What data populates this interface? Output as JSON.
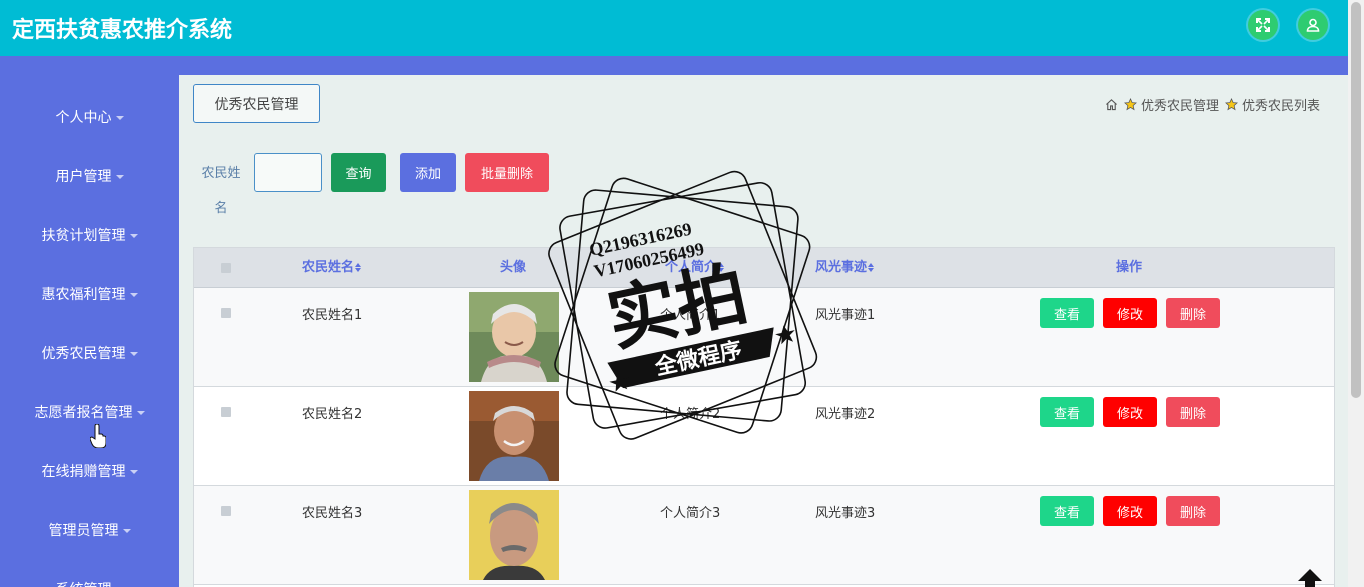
{
  "app": {
    "title": "定西扶贫惠农推介系统"
  },
  "header": {
    "fullscreen_icon": "fullscreen-icon",
    "user_icon": "user-icon",
    "accent_color": "#00bcd4",
    "button_color": "#2ecc71"
  },
  "sidebar": {
    "color": "#5b6fe0",
    "items": [
      {
        "label": "个人中心"
      },
      {
        "label": "用户管理"
      },
      {
        "label": "扶贫计划管理"
      },
      {
        "label": "惠农福利管理"
      },
      {
        "label": "优秀农民管理"
      },
      {
        "label": "志愿者报名管理"
      },
      {
        "label": "在线捐赠管理"
      },
      {
        "label": "管理员管理"
      },
      {
        "label": "系统管理"
      }
    ]
  },
  "page": {
    "title": "优秀农民管理",
    "breadcrumb": [
      "优秀农民管理",
      "优秀农民列表"
    ]
  },
  "search": {
    "label": "农民姓名",
    "value": "",
    "query_button": "查询",
    "add_button": "添加",
    "batch_delete_button": "批量删除"
  },
  "table": {
    "columns": [
      "农民姓名",
      "头像",
      "个人简介",
      "风光事迹",
      "操作"
    ],
    "rows": [
      {
        "name": "农民姓名1",
        "intro": "个人简介1",
        "story": "风光事迹1"
      },
      {
        "name": "农民姓名2",
        "intro": "个人简介2",
        "story": "风光事迹2"
      },
      {
        "name": "农民姓名3",
        "intro": "个人简介3",
        "story": "风光事迹3"
      }
    ],
    "actions": {
      "view": "查看",
      "edit": "修改",
      "delete": "删除"
    }
  },
  "watermark": {
    "line1": "Q2196316269",
    "line2": "V17060256499",
    "main": "实拍",
    "sub": "全微程序"
  }
}
